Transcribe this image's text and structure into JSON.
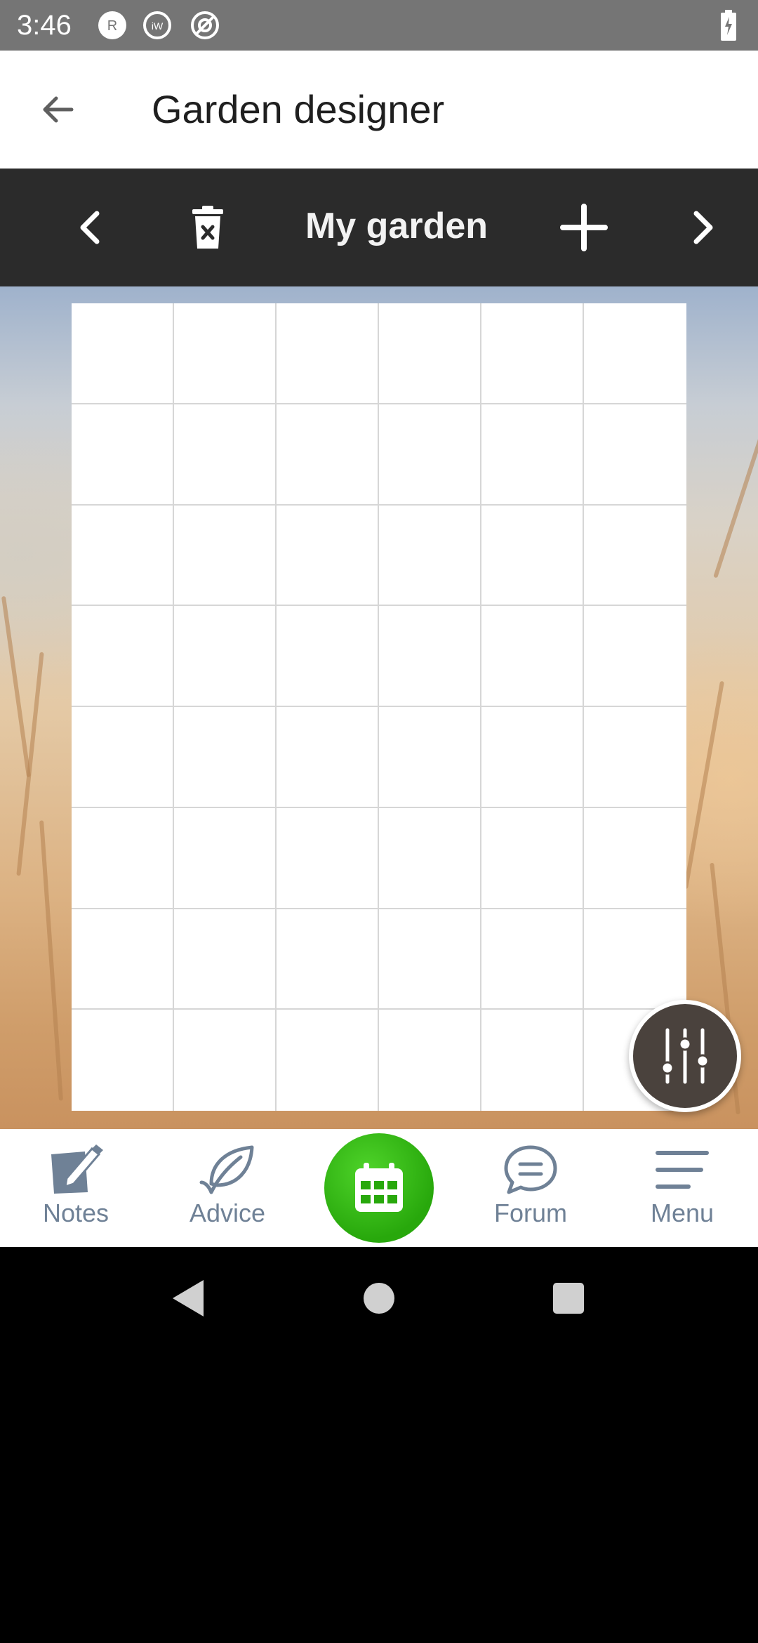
{
  "status_bar": {
    "time": "3:46",
    "icons": [
      "r-badge-icon",
      "iw-badge-icon",
      "location-off-icon",
      "battery-charging-icon"
    ]
  },
  "app_bar": {
    "title": "Garden designer",
    "back_icon": "arrow-left-icon"
  },
  "garden_toolbar": {
    "garden_name": "My garden",
    "prev_icon": "chevron-left-icon",
    "delete_icon": "delete-icon",
    "add_icon": "plus-icon",
    "next_icon": "chevron-right-icon"
  },
  "grid": {
    "columns": 6,
    "rows": 8
  },
  "bottom_nav": {
    "items": [
      {
        "label": "Notes",
        "icon": "notes-edit-icon"
      },
      {
        "label": "Advice",
        "icon": "leaf-icon"
      },
      {
        "label": "",
        "icon": "calendar-icon"
      },
      {
        "label": "Forum",
        "icon": "chat-bubble-icon"
      },
      {
        "label": "Menu",
        "icon": "hamburger-menu-icon"
      }
    ]
  },
  "colors": {
    "status_bar": "#757575",
    "toolbar": "#2b2b2b",
    "nav_text": "#6f8196",
    "calendar_green": "#28a80c"
  }
}
